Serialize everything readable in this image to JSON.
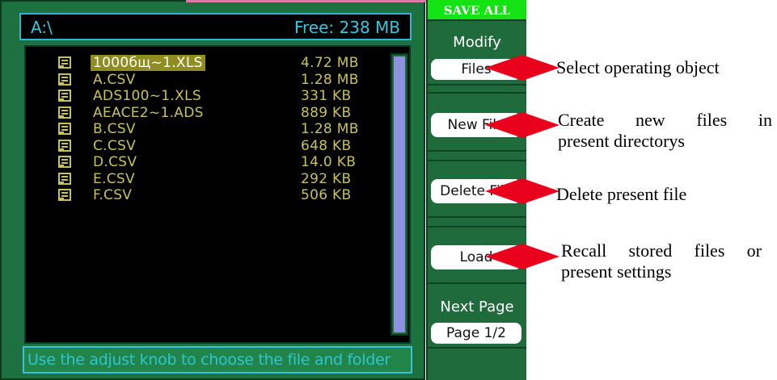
{
  "screen": {
    "path": "A:\\",
    "free_space": "Free: 238 MB",
    "files": [
      {
        "name": "1000бщ~1.XLS",
        "size": "4.72 MB",
        "selected": true
      },
      {
        "name": "A.CSV",
        "size": "1.28 MB"
      },
      {
        "name": "ADS100~1.XLS",
        "size": "331 KB"
      },
      {
        "name": "AEACE2~1.ADS",
        "size": "889 KB"
      },
      {
        "name": "B.CSV",
        "size": "1.28 MB"
      },
      {
        "name": "C.CSV",
        "size": "648 KB"
      },
      {
        "name": "D.CSV",
        "size": "14.0 KB"
      },
      {
        "name": "E.CSV",
        "size": "292 KB"
      },
      {
        "name": "F.CSV",
        "size": "506 KB"
      }
    ],
    "status": "Use the adjust knob to choose the file and folder"
  },
  "menu": {
    "title": "SAVE ALL",
    "modify_label": "Modify",
    "modify_value": "Files",
    "new_file": "New File",
    "delete_file": "Delete File",
    "load": "Load",
    "next_page_label": "Next Page",
    "page_value": "Page 1/2"
  },
  "annotations": {
    "select": "Select operating object",
    "create_line1": "Create new files in",
    "create_line2": "present directorys",
    "delete": "Delete present file",
    "recall_line1": "Recall stored files or",
    "recall_line2": "present settings"
  },
  "colors": {
    "arrow": "#e8001c",
    "menu_title_bg": "#13e313",
    "file_text": "#c7c25a",
    "path_text": "#36c7e0"
  },
  "icons": [
    "file-icon",
    "arrow-icon"
  ]
}
